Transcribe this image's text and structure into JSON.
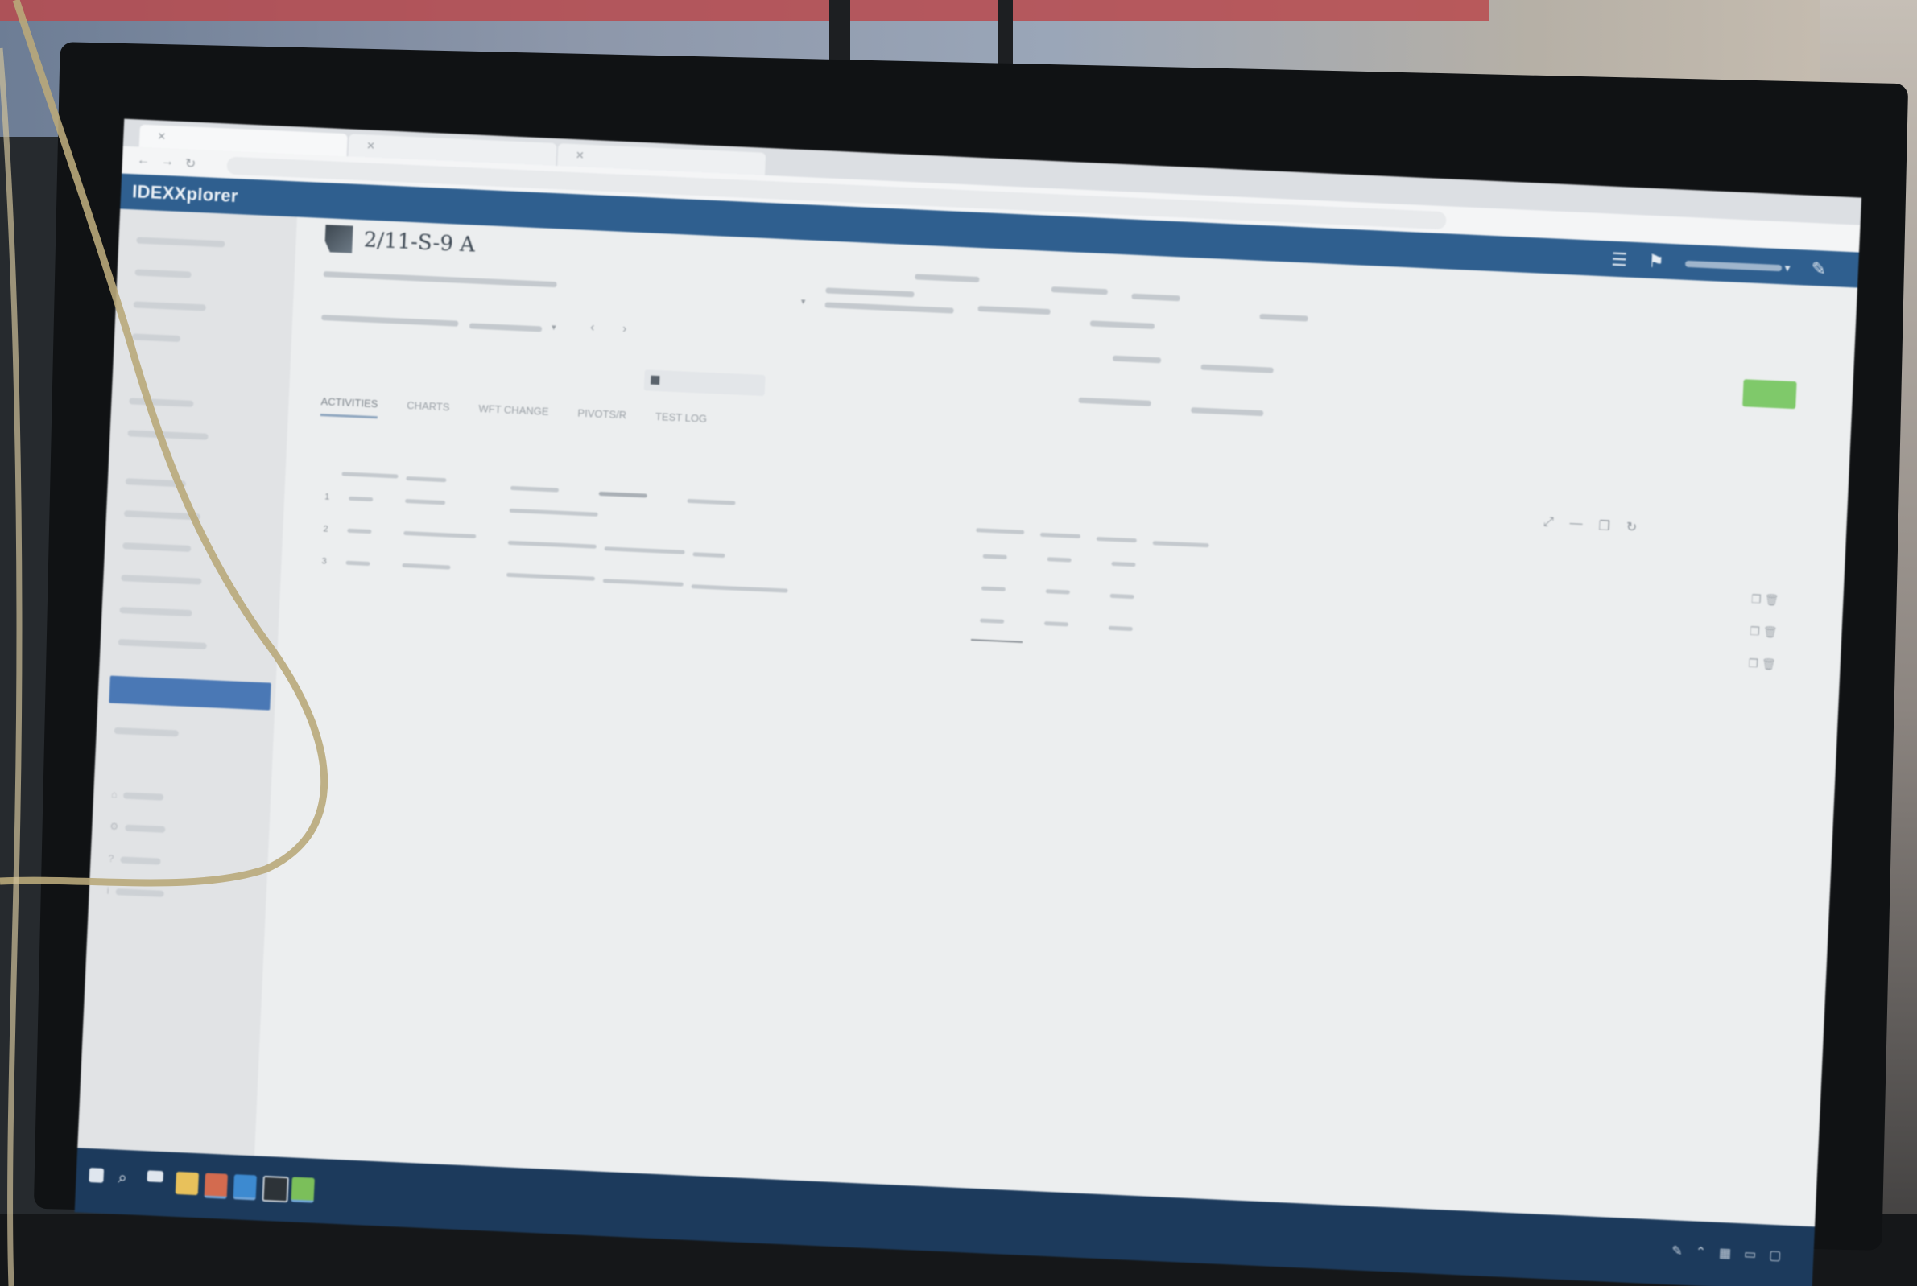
{
  "browser": {
    "tabs": [
      "",
      "",
      ""
    ],
    "url": ""
  },
  "app": {
    "brand": "IDEXXplorer",
    "page_title": "2/11-S-9 A",
    "colors": {
      "header": "#2f5f8f",
      "sidebar_active": "#4a78b5",
      "primary_button": "#7fc96a",
      "taskbar": "#1c3a5c"
    }
  },
  "header_icons": [
    "list-icon",
    "flag-icon",
    "pen-icon"
  ],
  "sidebar": {
    "active_item": ""
  },
  "tabs": [
    "ACTIVITIES",
    "CHARTS",
    "WFT CHANGE",
    "PIVOTS/R",
    "TEST LOG"
  ],
  "table": {
    "rows": [
      {
        "no": "1"
      },
      {
        "no": "2"
      },
      {
        "no": "3"
      }
    ]
  },
  "taskbar_icons": [
    "windows-icon",
    "search-icon",
    "taskview-icon",
    "folder-icon",
    "browser-icon",
    "mail-icon",
    "terminal-icon",
    "spreadsheet-icon"
  ]
}
